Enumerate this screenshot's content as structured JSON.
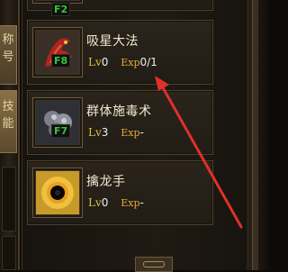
{
  "left_tabs": [
    {
      "label": "称号"
    },
    {
      "label": "技能"
    }
  ],
  "hotkey_partial": "F2",
  "skills": [
    {
      "name": "吸星大法",
      "key": "F8",
      "lv_label": "Lv",
      "level": "0",
      "exp_label": "Exp",
      "exp": "0/1",
      "icon": "red-dragon-skill-icon"
    },
    {
      "name": "群体施毒术",
      "key": "F7",
      "lv_label": "Lv",
      "level": "3",
      "exp_label": "Exp",
      "exp": "-",
      "icon": "poison-cloud-skill-icon"
    },
    {
      "name": "擒龙手",
      "key": "",
      "lv_label": "Lv",
      "level": "0",
      "exp_label": "Exp",
      "exp": "-",
      "icon": "black-orb-skill-icon"
    }
  ],
  "annotation": {
    "color": "#e0302a"
  },
  "colors": {
    "key_text": "#38c43a",
    "lv_label": "#e0c040",
    "exp_label": "#e7a93a"
  }
}
